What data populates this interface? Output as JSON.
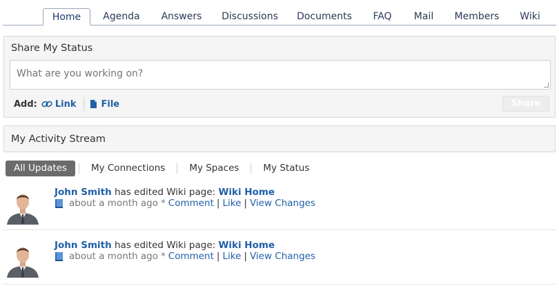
{
  "tabs": [
    {
      "label": "Home",
      "active": true
    },
    {
      "label": "Agenda"
    },
    {
      "label": "Answers"
    },
    {
      "label": "Discussions"
    },
    {
      "label": "Documents"
    },
    {
      "label": "FAQ"
    },
    {
      "label": "Mail"
    },
    {
      "label": "Members"
    },
    {
      "label": "Wiki"
    }
  ],
  "share": {
    "title": "Share My Status",
    "placeholder": "What are you working on?",
    "add_label": "Add:",
    "link_label": "Link",
    "file_label": "File",
    "button_label": "Share"
  },
  "stream": {
    "title": "My Activity Stream",
    "filters": [
      "All Updates",
      "My Connections",
      "My Spaces",
      "My Status"
    ],
    "items": [
      {
        "user": "John Smith",
        "action": "has edited Wiki page:",
        "target": "Wiki Home",
        "time": "about a month ago",
        "star": "*",
        "comment": "Comment",
        "like": "Like",
        "view_changes": "View Changes"
      },
      {
        "user": "John Smith",
        "action": "has edited Wiki page:",
        "target": "Wiki Home",
        "time": "about a month ago",
        "star": "*",
        "comment": "Comment",
        "like": "Like",
        "view_changes": "View Changes"
      }
    ]
  },
  "colors": {
    "link": "#1f5fa8",
    "active_filter": "#6b6b6b",
    "panel_bg": "#f5f5f5"
  }
}
